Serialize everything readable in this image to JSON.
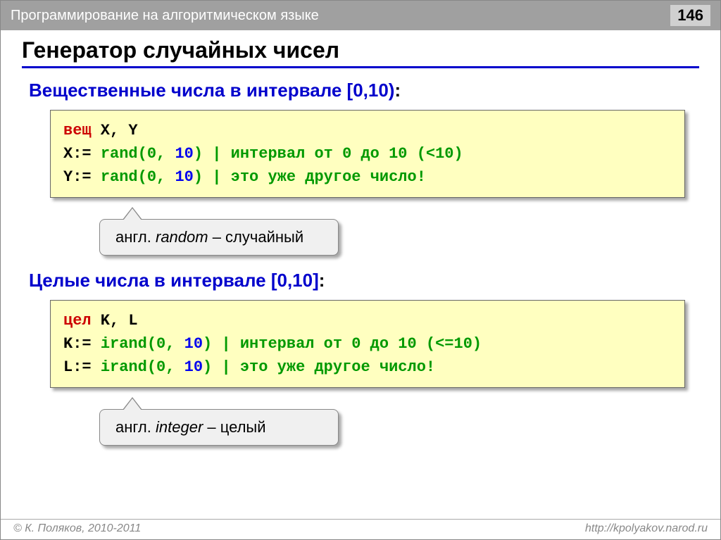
{
  "header": {
    "course": "Программирование на алгоритмическом языке",
    "page": "146"
  },
  "title": "Генератор случайных чисел",
  "section1": {
    "heading": "Вещественные числа в интервале [0,10)",
    "code": {
      "decl_kw": "вещ",
      "decl_vars": " X, Y",
      "l1_a": "X:= ",
      "l1_b": "rand(0, ",
      "l1_num": "10",
      "l1_c": ")",
      "l1_d": " | интервал от 0 до 10 (<10)",
      "l2_a": "Y:= ",
      "l2_b": "rand(0, ",
      "l2_num": "10",
      "l2_c": ")",
      "l2_d": " | это уже другое число!"
    },
    "callout_pre": "англ. ",
    "callout_word": "random",
    "callout_post": " – случайный"
  },
  "section2": {
    "heading": "Целые числа в интервале [0,10]",
    "code": {
      "decl_kw": "цел",
      "decl_vars": " K, L",
      "l1_a": "K:= ",
      "l1_b": "irand(0, ",
      "l1_num": "10",
      "l1_c": ")",
      "l1_d": " | интервал от 0 до 10 (<=10)",
      "l2_a": "L:= ",
      "l2_b": "irand(0, ",
      "l2_num": "10",
      "l2_c": ")",
      "l2_d": " | это уже другое число!"
    },
    "callout_pre": "англ. ",
    "callout_word": "integer",
    "callout_post": " – целый"
  },
  "footer": {
    "left": "© К. Поляков, 2010-2011",
    "right": "http://kpolyakov.narod.ru"
  }
}
